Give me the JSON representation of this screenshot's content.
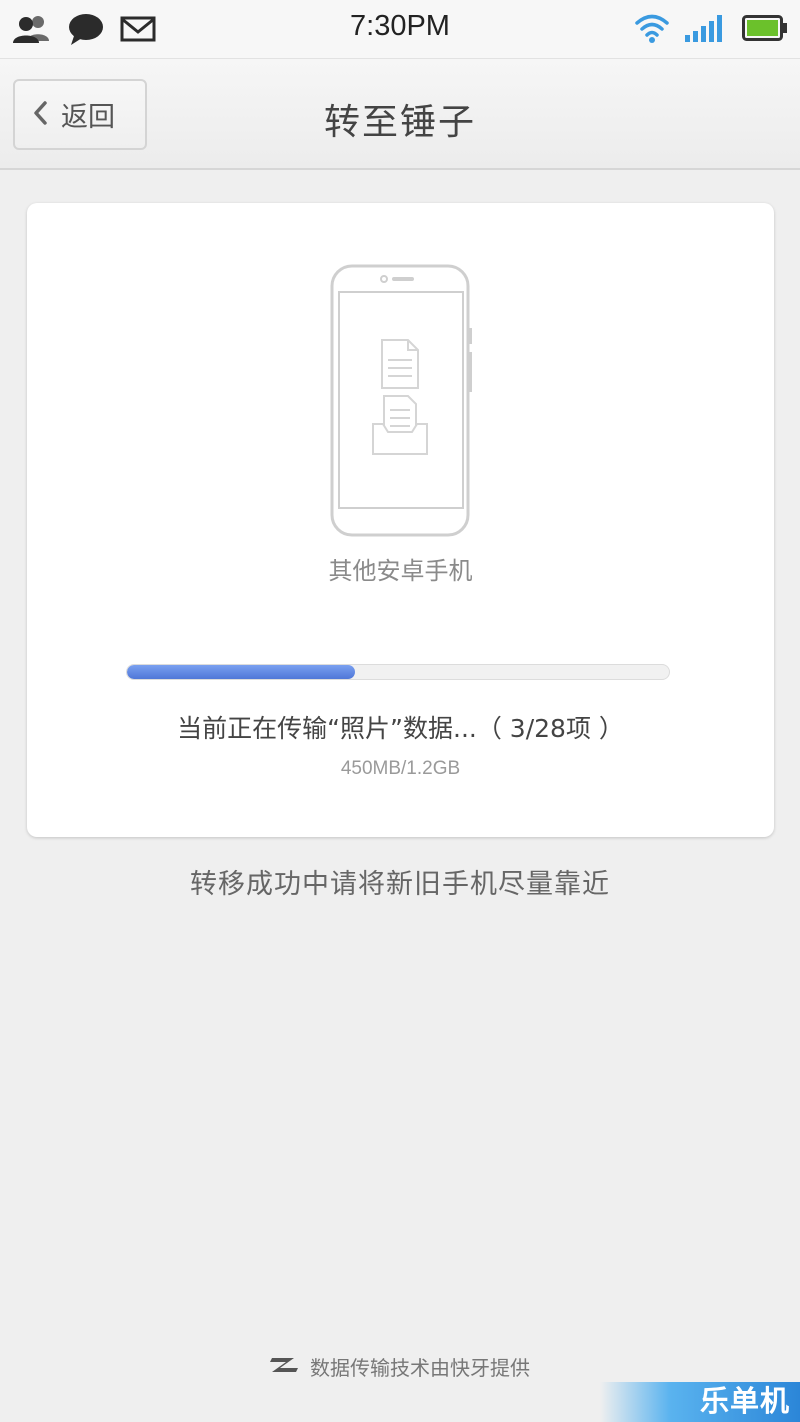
{
  "status_bar": {
    "time": "7:30PM",
    "left_icons": [
      "contacts-icon",
      "chat-bubble-icon",
      "mail-icon"
    ],
    "right_icons": [
      "wifi-icon",
      "signal-icon",
      "battery-icon"
    ],
    "accent_color": "#3a9ae0",
    "battery_color": "#6bc12b"
  },
  "header": {
    "back_label": "返回",
    "title": "转至锤子"
  },
  "card": {
    "device_label": "其他安卓手机",
    "progress_fraction": 0.42,
    "status_text": "当前正在传输“照片”数据...（ 3/28项 ）",
    "size_text": "450MB/1.2GB"
  },
  "hint": "转移成功中请将新旧手机尽量靠近",
  "footer": {
    "text": "数据传输技术由快牙提供",
    "logo_icon": "kuaiya-logo-icon"
  },
  "watermark": {
    "text": "乐单机"
  }
}
